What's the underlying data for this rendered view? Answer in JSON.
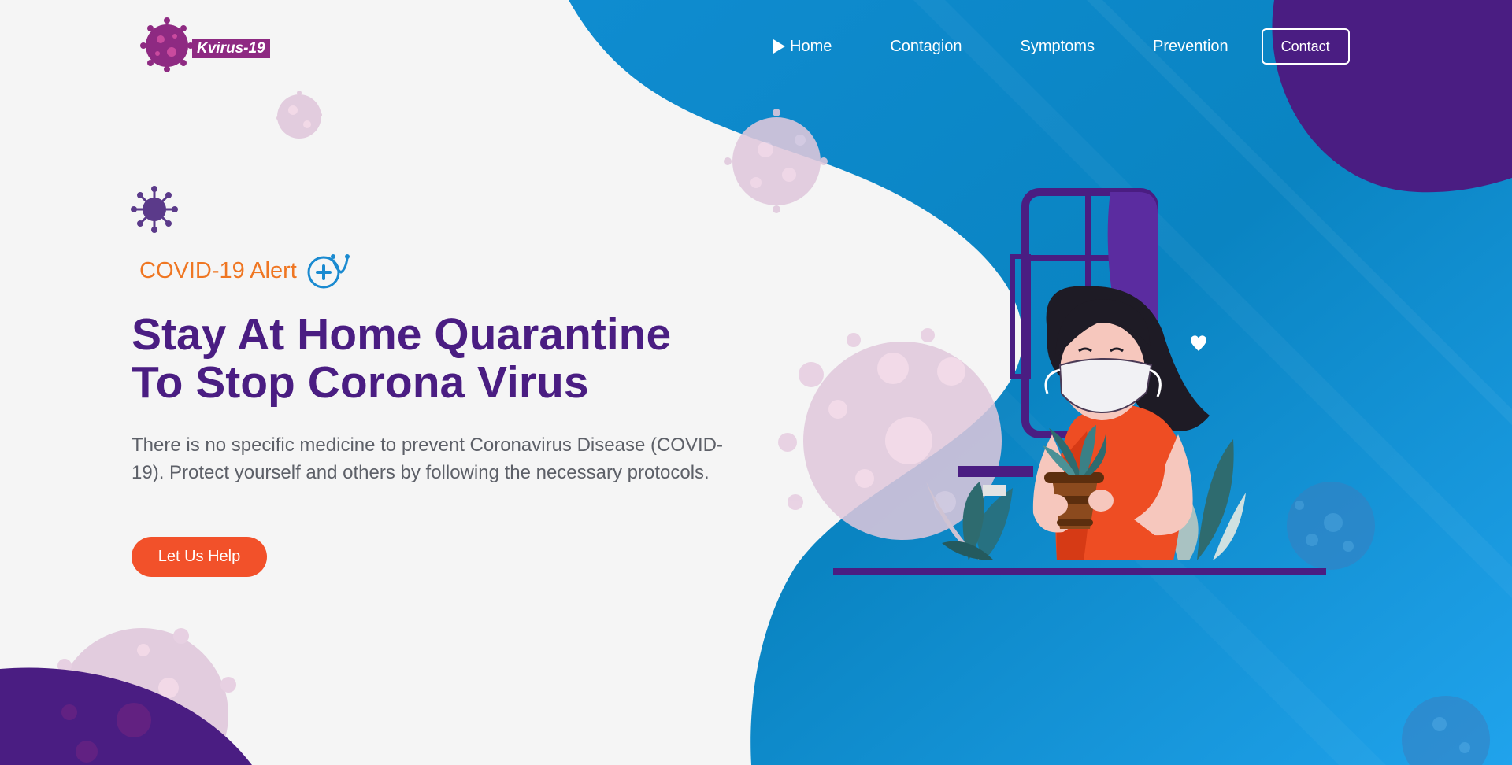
{
  "brand": {
    "name": "Kvirus-19"
  },
  "nav": {
    "items": [
      {
        "label": "Home",
        "active": true
      },
      {
        "label": "Contagion"
      },
      {
        "label": "Symptoms"
      },
      {
        "label": "Prevention"
      }
    ],
    "contact_label": "Contact"
  },
  "hero": {
    "alert": "COVID-19 Alert",
    "title_line1": "Stay At Home Quarantine",
    "title_line2": "To Stop Corona Virus",
    "description": "There is no specific medicine to prevent Coronavirus Disease (COVID-19). Protect yourself and others by following the necessary protocols.",
    "cta_label": "Let Us Help"
  },
  "icons": {
    "logo": "virus-icon",
    "alert": "stethoscope-plus-icon",
    "home": "play-icon",
    "decor": "virus-icon"
  },
  "colors": {
    "background": "#f5f5f5",
    "blue_wave": "#1a96dc",
    "purple": "#4a1d82",
    "orange": "#ef7622",
    "cta": "#f2512a",
    "virus_pink": "#e0c8dc"
  }
}
